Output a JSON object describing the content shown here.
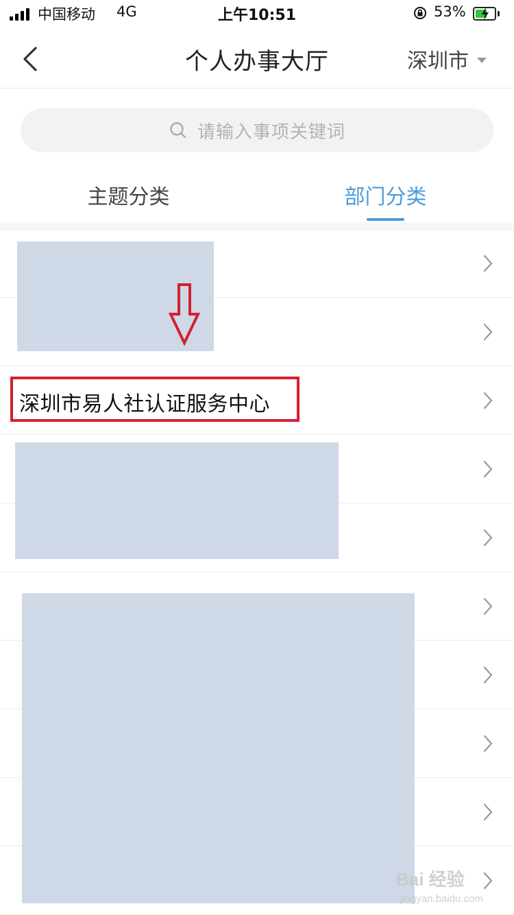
{
  "status_bar": {
    "carrier": "中国移动",
    "network": "4G",
    "time": "上午10:51",
    "battery_percent": "53%",
    "icons": [
      "signal-icon",
      "orientation-lock-icon",
      "battery-charging-icon"
    ]
  },
  "nav": {
    "title": "个人办事大厅",
    "city": "深圳市",
    "back_icon": "chevron-left-icon",
    "city_caret_icon": "caret-down-icon"
  },
  "search": {
    "placeholder": "请输入事项关键词",
    "icon": "search-icon"
  },
  "tabs": [
    {
      "label": "主题分类",
      "active": false
    },
    {
      "label": "部门分类",
      "active": true
    }
  ],
  "list": {
    "items": [
      {
        "label": ""
      },
      {
        "label": ""
      },
      {
        "label": "深圳市易人社认证服务中心"
      },
      {
        "label": ""
      },
      {
        "label": ""
      },
      {
        "label": ""
      },
      {
        "label": ""
      },
      {
        "label": ""
      },
      {
        "label": ""
      },
      {
        "label": ""
      }
    ],
    "chevron_icon": "chevron-right-icon"
  },
  "colors": {
    "accent": "#4a9bd8",
    "highlight": "#d32030",
    "redaction": "#cfd8e6"
  },
  "watermark": {
    "main": "Bai 经验",
    "sub": "jingyan.baidu.com"
  }
}
